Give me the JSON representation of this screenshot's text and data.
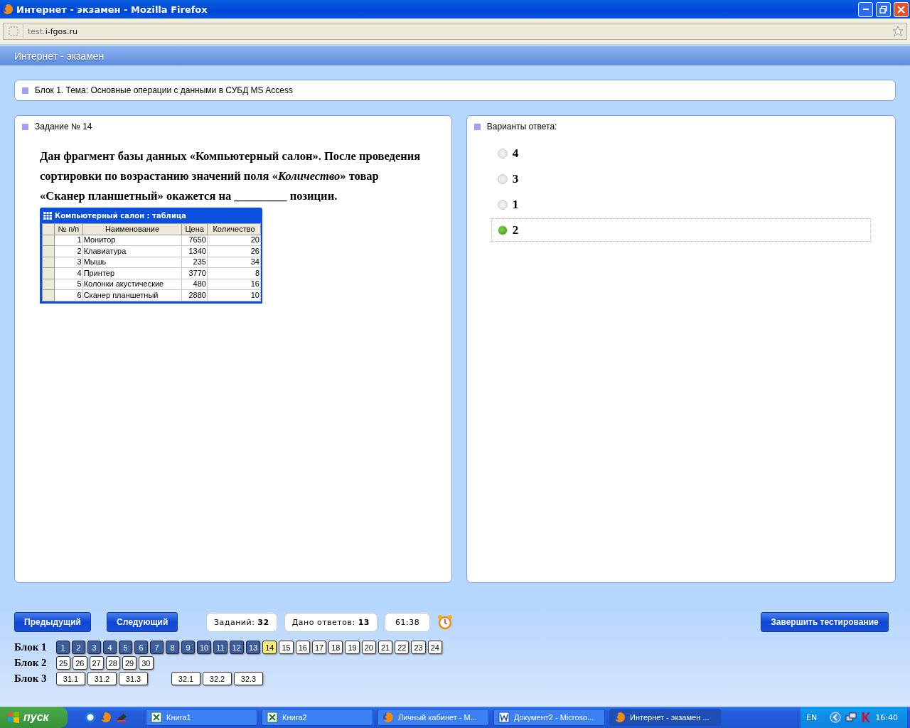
{
  "window": {
    "title": "Интернет - экзамен - Mozilla Firefox"
  },
  "address_bar": {
    "domain_prefix": "test.",
    "domain": "i-fgos.ru"
  },
  "app_header": {
    "title": "Интернет - экзамен"
  },
  "topic": "Блок 1. Тема: Основные операции с данными в СУБД MS Access",
  "task": {
    "heading": "Задание № 14",
    "question": "Дан фрагмент базы данных «Компьютерный салон». После проведения сортировки по возрастанию значений поля «*Количество*» товар «Сканер планшетный» окажется на _________ позиции.",
    "table_window": {
      "title": "Компьютерный салон : таблица",
      "columns": [
        "№ п/п",
        "Наименование",
        "Цена",
        "Количество"
      ],
      "rows": [
        [
          "1",
          "Монитор",
          "7650",
          "20"
        ],
        [
          "2",
          "Клавиатура",
          "1340",
          "26"
        ],
        [
          "3",
          "Мышь",
          "235",
          "34"
        ],
        [
          "4",
          "Принтер",
          "3770",
          "8"
        ],
        [
          "5",
          "Колонки акустические",
          "480",
          "16"
        ],
        [
          "6",
          "Сканер планшетный",
          "2880",
          "10"
        ]
      ]
    }
  },
  "answers": {
    "heading": "Варианты ответа:",
    "options": [
      {
        "label": "4",
        "selected": false
      },
      {
        "label": "3",
        "selected": false
      },
      {
        "label": "1",
        "selected": false
      },
      {
        "label": "2",
        "selected": true
      }
    ]
  },
  "footer": {
    "prev_button": "Предыдущий",
    "next_button": "Следующий",
    "counters": [
      {
        "label": "Заданий:",
        "value": "32"
      },
      {
        "label": "Дано ответов:",
        "value": "13"
      }
    ],
    "timer": "61:38",
    "finish_button": "Завершить тестирование",
    "blocks": [
      {
        "label": "Блок 1",
        "groups": [
          [
            {
              "n": "1",
              "answered": true,
              "current": false
            },
            {
              "n": "2",
              "answered": true,
              "current": false
            },
            {
              "n": "3",
              "answered": true,
              "current": false
            },
            {
              "n": "4",
              "answered": true,
              "current": false
            },
            {
              "n": "5",
              "answered": true,
              "current": false
            },
            {
              "n": "6",
              "answered": true,
              "current": false
            },
            {
              "n": "7",
              "answered": true,
              "current": false
            },
            {
              "n": "8",
              "answered": true,
              "current": false
            },
            {
              "n": "9",
              "answered": true,
              "current": false
            },
            {
              "n": "10",
              "answered": true,
              "current": false
            },
            {
              "n": "11",
              "answered": true,
              "current": false
            },
            {
              "n": "12",
              "answered": true,
              "current": false
            },
            {
              "n": "13",
              "answered": true,
              "current": false
            },
            {
              "n": "14",
              "answered": false,
              "current": true
            },
            {
              "n": "15",
              "answered": false,
              "current": false
            },
            {
              "n": "16",
              "answered": false,
              "current": false
            },
            {
              "n": "17",
              "answered": false,
              "current": false
            },
            {
              "n": "18",
              "answered": false,
              "current": false
            },
            {
              "n": "19",
              "answered": false,
              "current": false
            },
            {
              "n": "20",
              "answered": false,
              "current": false
            },
            {
              "n": "21",
              "answered": false,
              "current": false
            },
            {
              "n": "22",
              "answered": false,
              "current": false
            },
            {
              "n": "23",
              "answered": false,
              "current": false
            },
            {
              "n": "24",
              "answered": false,
              "current": false
            }
          ]
        ]
      },
      {
        "label": "Блок 2",
        "groups": [
          [
            {
              "n": "25",
              "answered": false,
              "current": false
            },
            {
              "n": "26",
              "answered": false,
              "current": false
            },
            {
              "n": "27",
              "answered": false,
              "current": false
            },
            {
              "n": "28",
              "answered": false,
              "current": false
            },
            {
              "n": "29",
              "answered": false,
              "current": false
            },
            {
              "n": "30",
              "answered": false,
              "current": false
            }
          ]
        ]
      },
      {
        "label": "Блок 3",
        "groups": [
          [
            {
              "n": "31.1",
              "answered": false,
              "current": false
            },
            {
              "n": "31.2",
              "answered": false,
              "current": false
            },
            {
              "n": "31.3",
              "answered": false,
              "current": false
            }
          ],
          [
            {
              "n": "32.1",
              "answered": false,
              "current": false
            },
            {
              "n": "32.2",
              "answered": false,
              "current": false
            },
            {
              "n": "32.3",
              "answered": false,
              "current": false
            }
          ]
        ]
      }
    ]
  },
  "taskbar": {
    "start_button": "пуск",
    "tasks": [
      {
        "label": "Книга1",
        "kind": "excel",
        "selected": false
      },
      {
        "label": "Книга2",
        "kind": "excel",
        "selected": false
      },
      {
        "label": "Личный кабинет - M...",
        "kind": "firefox",
        "selected": false
      },
      {
        "label": "Документ2 - Microso...",
        "kind": "word",
        "selected": false
      },
      {
        "label": "Интернет - экзамен ...",
        "kind": "firefox",
        "selected": true
      }
    ],
    "language": "EN",
    "clock": "16:40"
  }
}
